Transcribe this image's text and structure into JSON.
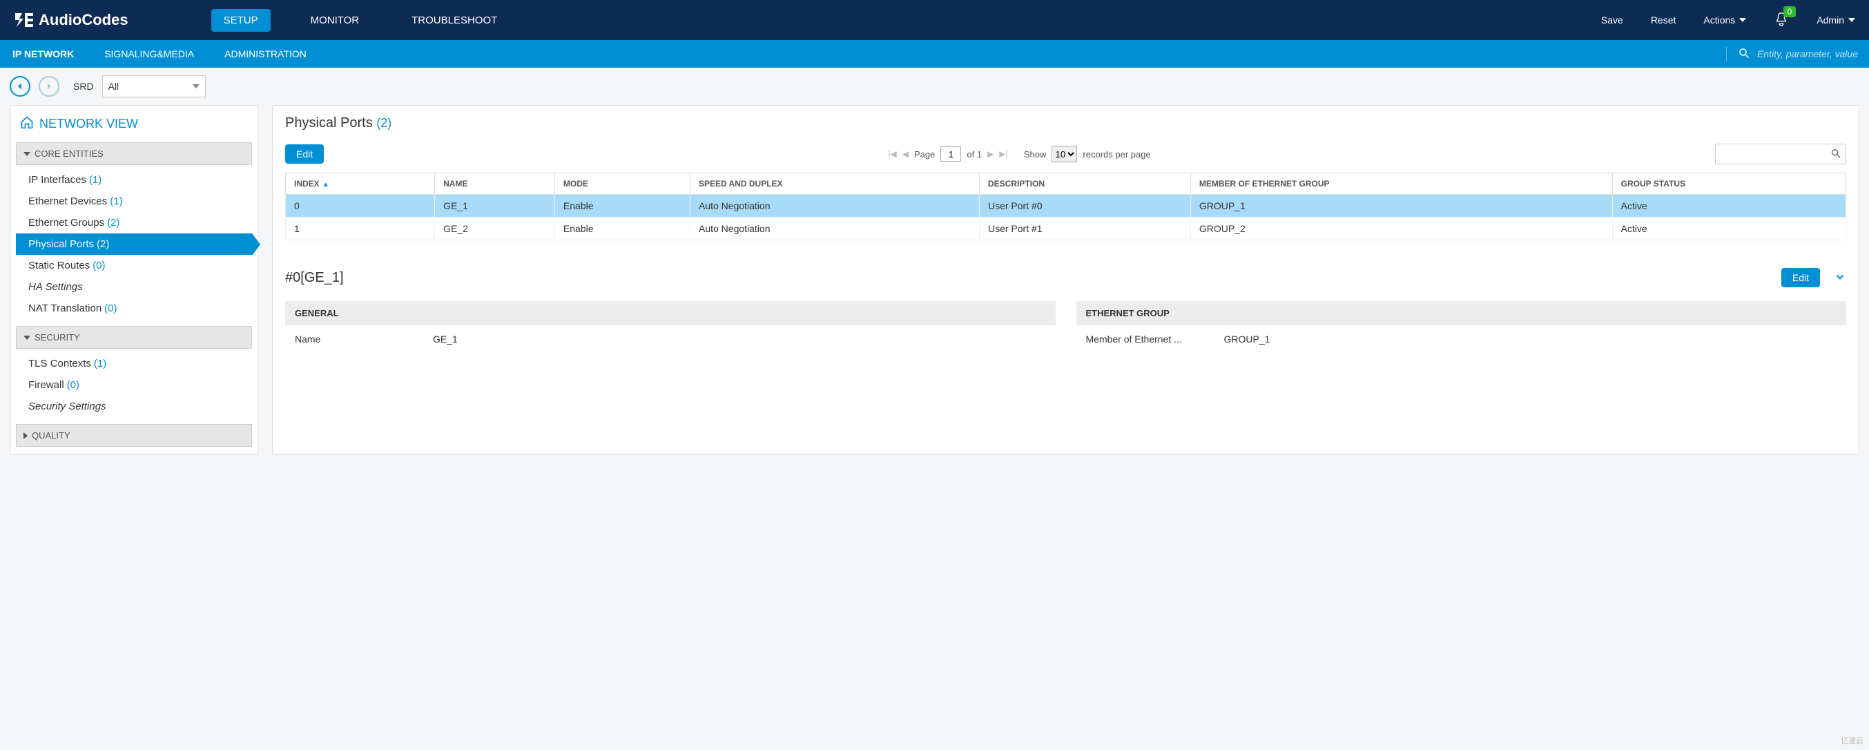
{
  "brand": "AudioCodes",
  "topTabs": [
    "SETUP",
    "MONITOR",
    "TROUBLESHOOT"
  ],
  "topTabActive": 0,
  "topRight": {
    "save": "Save",
    "reset": "Reset",
    "actions": "Actions",
    "notifications": "0",
    "admin": "Admin"
  },
  "subTabs": [
    "IP NETWORK",
    "SIGNALING&MEDIA",
    "ADMINISTRATION"
  ],
  "subTabActive": 0,
  "searchPlaceholder": "Entity, parameter, value",
  "srd": {
    "label": "SRD",
    "value": "All"
  },
  "networkView": "NETWORK VIEW",
  "sections": [
    {
      "title": "CORE ENTITIES",
      "items": [
        {
          "label": "IP Interfaces",
          "count": "(1)"
        },
        {
          "label": "Ethernet Devices",
          "count": "(1)"
        },
        {
          "label": "Ethernet Groups",
          "count": "(2)"
        },
        {
          "label": "Physical Ports",
          "count": "(2)",
          "active": true
        },
        {
          "label": "Static Routes",
          "count": "(0)"
        },
        {
          "label": "HA Settings",
          "italic": true
        },
        {
          "label": "NAT Translation",
          "count": "(0)"
        }
      ]
    },
    {
      "title": "SECURITY",
      "items": [
        {
          "label": "TLS Contexts",
          "count": "(1)"
        },
        {
          "label": "Firewall",
          "count": "(0)"
        },
        {
          "label": "Security Settings",
          "italic": true
        }
      ]
    },
    {
      "title": "QUALITY",
      "collapsed": true,
      "items": []
    }
  ],
  "page": {
    "title": "Physical Ports",
    "count": "(2)",
    "editLabel": "Edit",
    "pager": {
      "pageLabel": "Page",
      "page": "1",
      "ofLabel": "of 1",
      "showLabel": "Show",
      "pageSize": "10",
      "recordsLabel": "records per page"
    },
    "columns": [
      "INDEX",
      "NAME",
      "MODE",
      "SPEED AND DUPLEX",
      "DESCRIPTION",
      "MEMBER OF ETHERNET GROUP",
      "GROUP STATUS"
    ],
    "rows": [
      {
        "selected": true,
        "cells": [
          "0",
          "GE_1",
          "Enable",
          "Auto Negotiation",
          "User Port #0",
          "GROUP_1",
          "Active"
        ]
      },
      {
        "selected": false,
        "cells": [
          "1",
          "GE_2",
          "Enable",
          "Auto Negotiation",
          "User Port #1",
          "GROUP_2",
          "Active"
        ]
      }
    ]
  },
  "detail": {
    "title": "#0[GE_1]",
    "editLabel": "Edit",
    "general": {
      "header": "GENERAL",
      "nameLabel": "Name",
      "nameValue": "GE_1"
    },
    "group": {
      "header": "ETHERNET GROUP",
      "memberLabel": "Member of Ethernet ...",
      "memberValue": "GROUP_1"
    }
  },
  "watermark": "亿速云"
}
